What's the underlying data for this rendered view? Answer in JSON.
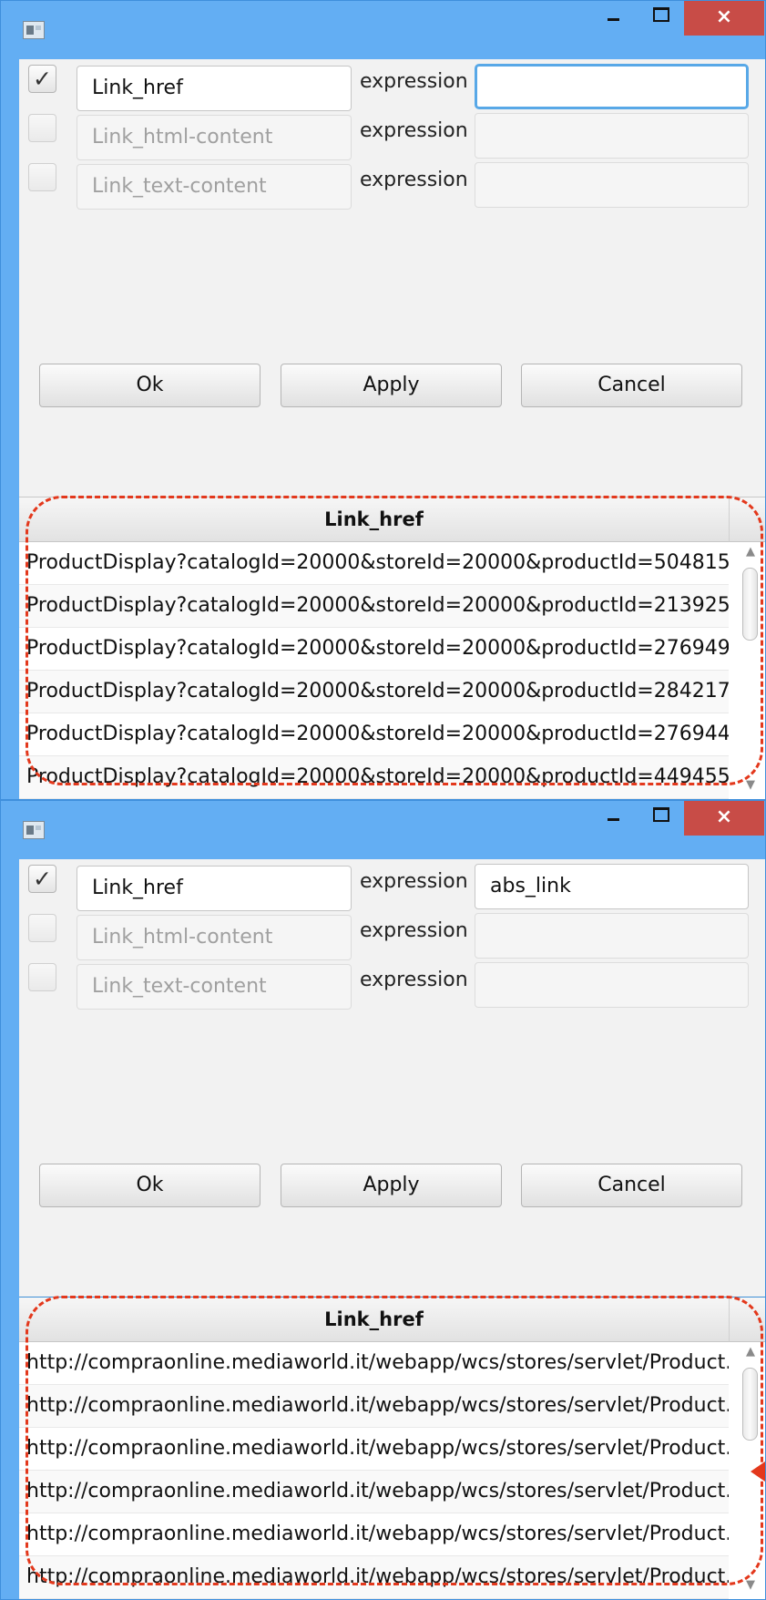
{
  "title_bar": {
    "minimize_label": "",
    "maximize_label": "",
    "close_label": "×"
  },
  "dialog_before": {
    "fields": [
      {
        "checked": "✓",
        "name": "Link_href",
        "expression_label": "expression",
        "expression_value": ""
      },
      {
        "checked": "",
        "name": "Link_html-content",
        "expression_label": "expression",
        "expression_value": ""
      },
      {
        "checked": "",
        "name": "Link_text-content",
        "expression_label": "expression",
        "expression_value": ""
      }
    ],
    "buttons": {
      "ok": "Ok",
      "apply": "Apply",
      "cancel": "Cancel"
    },
    "table": {
      "header": "Link_href",
      "rows": [
        "ProductDisplay?catalogId=20000&storeId=20000&productId=504815...",
        "ProductDisplay?catalogId=20000&storeId=20000&productId=213925...",
        "ProductDisplay?catalogId=20000&storeId=20000&productId=276949...",
        "ProductDisplay?catalogId=20000&storeId=20000&productId=284217...",
        "ProductDisplay?catalogId=20000&storeId=20000&productId=276944...",
        "ProductDisplay?catalogId=20000&storeId=20000&productId=449455..."
      ]
    }
  },
  "dialog_after": {
    "fields": [
      {
        "checked": "✓",
        "name": "Link_href",
        "expression_label": "expression",
        "expression_value": "abs_link"
      },
      {
        "checked": "",
        "name": "Link_html-content",
        "expression_label": "expression",
        "expression_value": ""
      },
      {
        "checked": "",
        "name": "Link_text-content",
        "expression_label": "expression",
        "expression_value": ""
      }
    ],
    "buttons": {
      "ok": "Ok",
      "apply": "Apply",
      "cancel": "Cancel"
    },
    "table": {
      "header": "Link_href",
      "rows": [
        "http://compraonline.mediaworld.it/webapp/wcs/stores/servlet/Product...",
        "http://compraonline.mediaworld.it/webapp/wcs/stores/servlet/Product...",
        "http://compraonline.mediaworld.it/webapp/wcs/stores/servlet/Product...",
        "http://compraonline.mediaworld.it/webapp/wcs/stores/servlet/Product...",
        "http://compraonline.mediaworld.it/webapp/wcs/stores/servlet/Product...",
        "http://compraonline.mediaworld.it/webapp/wcs/stores/servlet/Product..."
      ]
    }
  },
  "colors": {
    "title_bar": "#63aef3",
    "close_button": "#c84c47",
    "highlight_dashes": "#e3381c",
    "focus_border": "#58a8e7"
  },
  "icons": [
    "app-icon",
    "minimize-icon",
    "maximize-icon",
    "close-icon",
    "check-icon",
    "scroll-up-icon",
    "scroll-down-icon",
    "annotation-arrow-icon"
  ]
}
